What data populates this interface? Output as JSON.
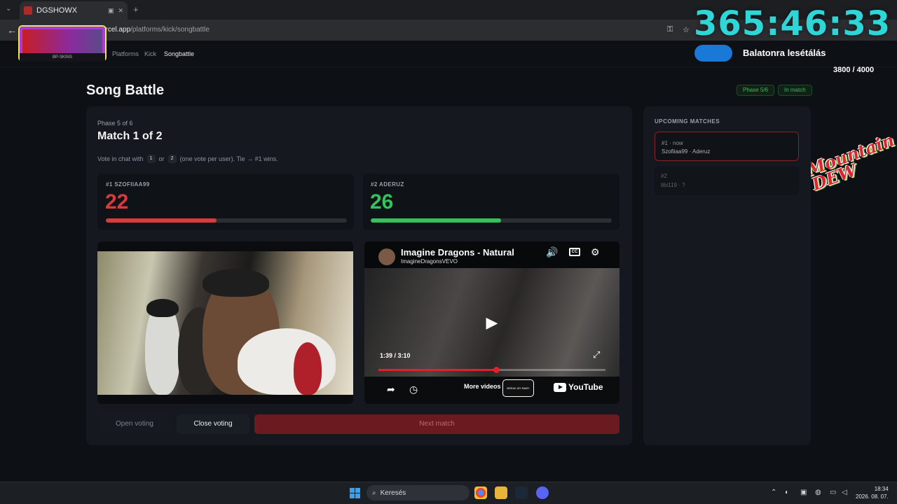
{
  "browser": {
    "tab_title": "DGSHOWX",
    "url_prefix": "ercel.app",
    "url_path": "/platforms/kick/songbattle"
  },
  "overlay": {
    "timer": "365:46:33",
    "goal_text": "Balatonra lesétálás",
    "goal_count": "3800 / 4000",
    "goal_progress": 0.95,
    "logo_strip": "BP-SKINS",
    "sponsor_line1": "Mountain",
    "sponsor_line2": "DEW"
  },
  "breadcrumb": [
    "Platforms",
    "Kick",
    "Songbattle"
  ],
  "page": {
    "title": "Song Battle",
    "badge_phase": "Phase 5/6",
    "badge_status": "In match"
  },
  "match": {
    "phase_label": "Phase 5 of 6",
    "title": "Match 1 of 2",
    "hint_prefix": "Vote in chat with",
    "key1": "1",
    "hint_or": "or",
    "key2": "2",
    "hint_suffix": "(one vote per user). Tie → #1 wins.",
    "contestants": [
      {
        "label": "#1 SZOFIIAA99",
        "votes": "22",
        "share": 0.458,
        "color": "#d93a3a"
      },
      {
        "label": "#2 ADERUZ",
        "votes": "26",
        "share": 0.542,
        "color": "#35c25a"
      }
    ]
  },
  "youtube": {
    "title": "Imagine Dragons - Natural",
    "channel": "ImagineDragonsVEVO",
    "time": "1:39 / 3:10",
    "progress": 0.52,
    "more_videos": "More videos",
    "thumb_text": "BREAK MY BABY",
    "logo_text": "YouTube",
    "cc": "CC"
  },
  "buttons": {
    "open_voting": "Open voting",
    "close_voting": "Close voting",
    "next_match": "Next match"
  },
  "upcoming": {
    "title": "UPCOMING MATCHES",
    "items": [
      {
        "meta": "#1 · now",
        "players": "Szofiiaa99 · Aderuz"
      },
      {
        "meta": "#2",
        "players": "tibi119 · ?"
      }
    ]
  },
  "taskbar": {
    "search_placeholder": "Keresés",
    "time": "18:34",
    "date": "2026. 08. 07."
  },
  "colors": {
    "accent_red": "#d93a3a",
    "accent_green": "#35c25a",
    "timer_cyan": "#2fd6d8",
    "next_btn": "#6b1b1f"
  }
}
